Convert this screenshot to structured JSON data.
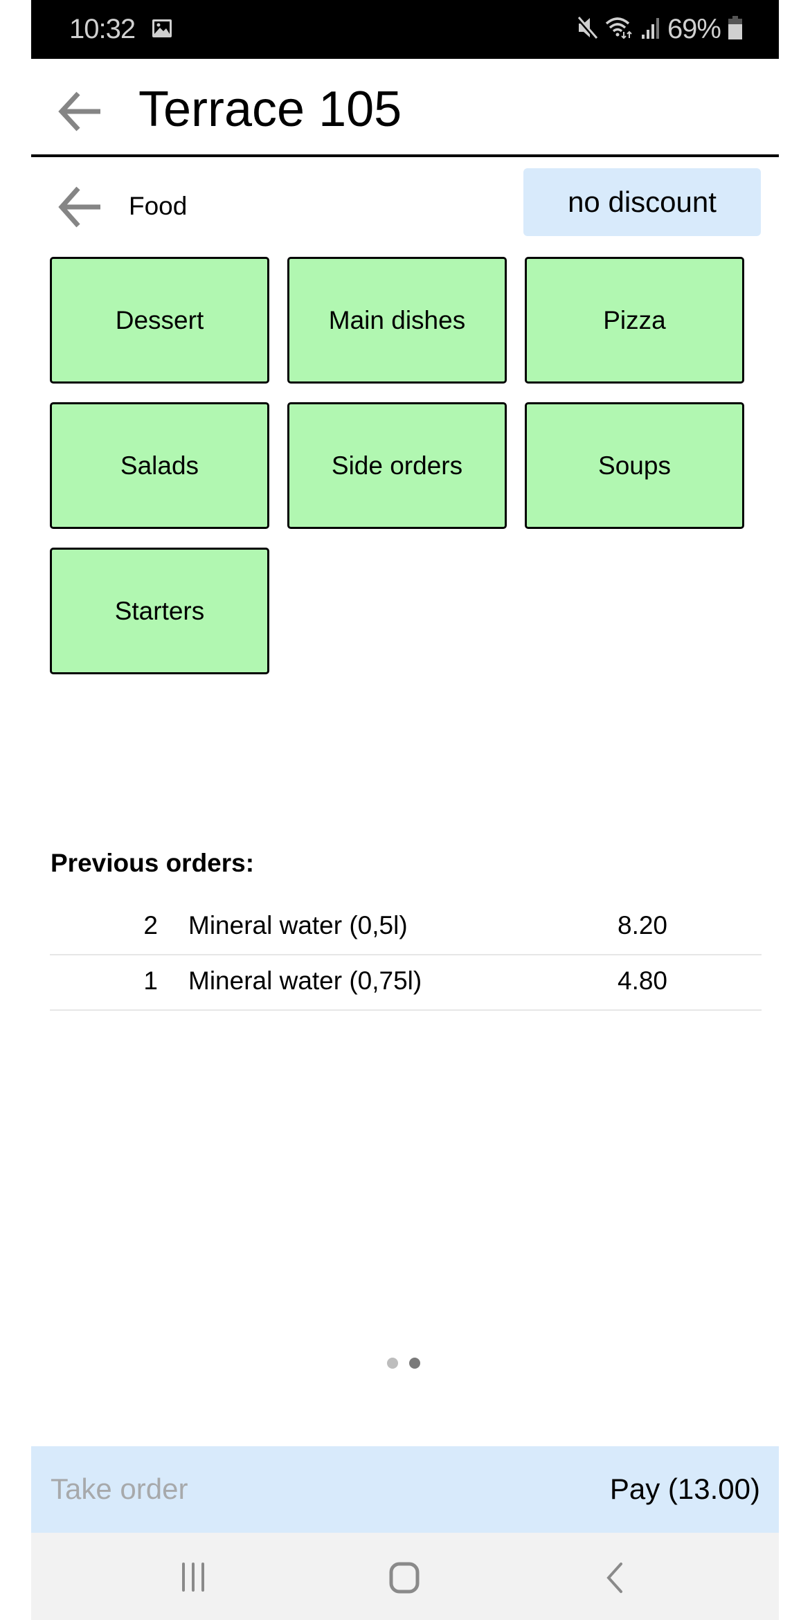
{
  "status_bar": {
    "time": "10:32",
    "battery_percent": "69%",
    "icons": [
      "gallery-icon",
      "mute-icon",
      "wifi-icon",
      "signal-icon",
      "battery-icon"
    ]
  },
  "header": {
    "title": "Terrace 105",
    "back_icon": "arrow-left-icon"
  },
  "category_nav": {
    "current": "Food",
    "back_icon": "arrow-left-icon",
    "discount_label": "no discount"
  },
  "categories": [
    {
      "label": "Dessert"
    },
    {
      "label": "Main dishes"
    },
    {
      "label": "Pizza"
    },
    {
      "label": "Salads"
    },
    {
      "label": "Side orders"
    },
    {
      "label": "Soups"
    },
    {
      "label": "Starters"
    }
  ],
  "previous_orders": {
    "title": "Previous orders:",
    "rows": [
      {
        "qty": "2",
        "name": "Mineral water (0,5l)",
        "price": "8.20"
      },
      {
        "qty": "1",
        "name": "Mineral water (0,75l)",
        "price": "4.80"
      }
    ]
  },
  "pager": {
    "pages": 2,
    "current": 2
  },
  "action_bar": {
    "take_order_label": "Take order",
    "pay_label": "Pay (13.00)"
  },
  "colors": {
    "tile": "#b1f7b1",
    "accent_bar": "#d8eafb",
    "disabled_text": "#a7a9ab",
    "dot_inactive": "#bdbdbd",
    "dot_active": "#7a7a7a"
  },
  "system_nav": {
    "icons": [
      "recents-icon",
      "home-icon",
      "back-icon"
    ]
  }
}
